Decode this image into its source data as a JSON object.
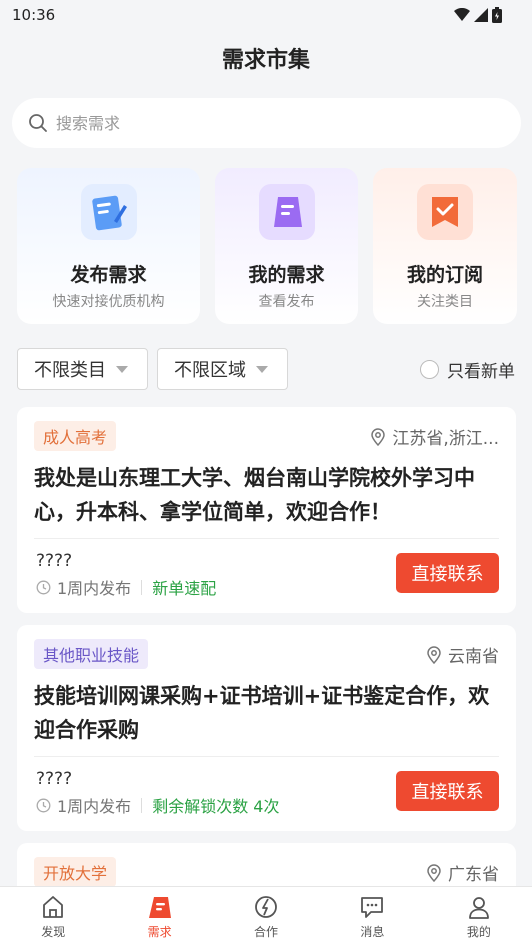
{
  "status": {
    "time": "10:36"
  },
  "header": {
    "title": "需求市集"
  },
  "search": {
    "placeholder": "搜索需求"
  },
  "quick_actions": [
    {
      "title": "发布需求",
      "subtitle": "快速对接优质机构",
      "icon": "publish-icon"
    },
    {
      "title": "我的需求",
      "subtitle": "查看发布",
      "icon": "my-demands-icon"
    },
    {
      "title": "我的订阅",
      "subtitle": "关注类目",
      "icon": "subscription-icon"
    }
  ],
  "filters": {
    "category": "不限类目",
    "region": "不限区域",
    "only_new_label": "只看新单"
  },
  "cards": [
    {
      "tag": "成人高考",
      "location": "江苏省,浙江...",
      "title": "我处是山东理工大学、烟台南山学院校外学习中心，升本科、拿学位简单，欢迎合作！",
      "contact_name": "????",
      "time": "1周内发布",
      "note": "新单速配",
      "button": "直接联系"
    },
    {
      "tag": "其他职业技能",
      "location": "云南省",
      "title": "技能培训网课采购+证书培训+证书鉴定合作，欢迎合作采购",
      "contact_name": "????",
      "time": "1周内发布",
      "note": "剩余解锁次数 4次",
      "button": "直接联系"
    },
    {
      "tag": "开放大学",
      "location": "广东省"
    }
  ],
  "tabbar": [
    {
      "label": "发现",
      "icon": "home-icon"
    },
    {
      "label": "需求",
      "icon": "demand-icon"
    },
    {
      "label": "合作",
      "icon": "cooperation-icon"
    },
    {
      "label": "消息",
      "icon": "message-icon"
    },
    {
      "label": "我的",
      "icon": "profile-icon"
    }
  ],
  "colors": {
    "accent": "#ee4a30",
    "green": "#2ba244",
    "tag_orange": "#e2703a",
    "tag_purple": "#6a57c7"
  }
}
